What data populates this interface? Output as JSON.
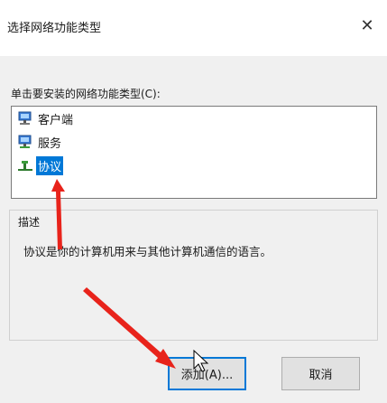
{
  "dialog": {
    "title": "选择网络功能类型",
    "close_glyph": "✕"
  },
  "prompt": "单击要安装的网络功能类型(C):",
  "list": {
    "items": [
      {
        "label": "客户端",
        "icon": "computer-network-icon",
        "selected": false
      },
      {
        "label": "服务",
        "icon": "computer-network-icon",
        "selected": false
      },
      {
        "label": "协议",
        "icon": "network-protocol-icon",
        "selected": true
      }
    ]
  },
  "description": {
    "title": "描述",
    "text": "协议是你的计算机用来与其他计算机通信的语言。"
  },
  "buttons": {
    "add": "添加(A)...",
    "cancel": "取消"
  },
  "colors": {
    "selection": "#0078d7",
    "annotation_arrow": "#e8231b"
  }
}
